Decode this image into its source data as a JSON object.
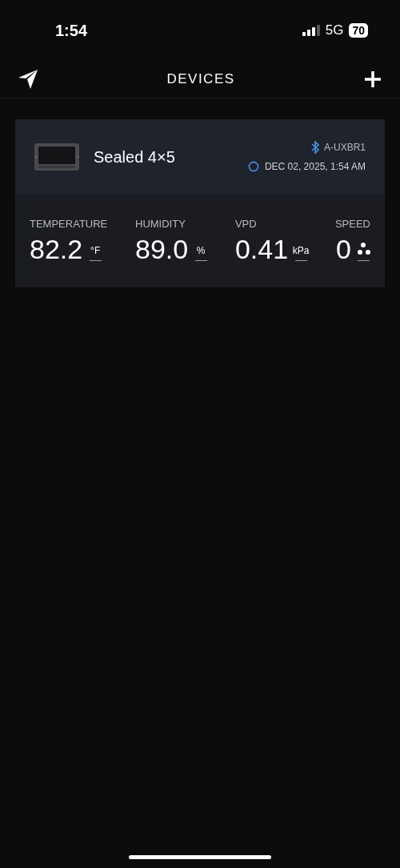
{
  "status_bar": {
    "time": "1:54",
    "network": "5G",
    "battery": "70"
  },
  "header": {
    "title": "DEVICES"
  },
  "device": {
    "name": "Sealed 4×5",
    "bluetooth_id": "A-UXBR1",
    "timestamp": "DEC 02, 2025, 1:54 AM",
    "metrics": [
      {
        "label": "TEMPERATURE",
        "value": "82.2",
        "kind": "unit",
        "unit": "°F"
      },
      {
        "label": "HUMIDITY",
        "value": "89.0",
        "kind": "unit",
        "unit": "%"
      },
      {
        "label": "VPD",
        "value": "0.41",
        "kind": "unit",
        "unit": "kPa"
      },
      {
        "label": "SPEED",
        "value": "0",
        "kind": "fan"
      }
    ]
  }
}
